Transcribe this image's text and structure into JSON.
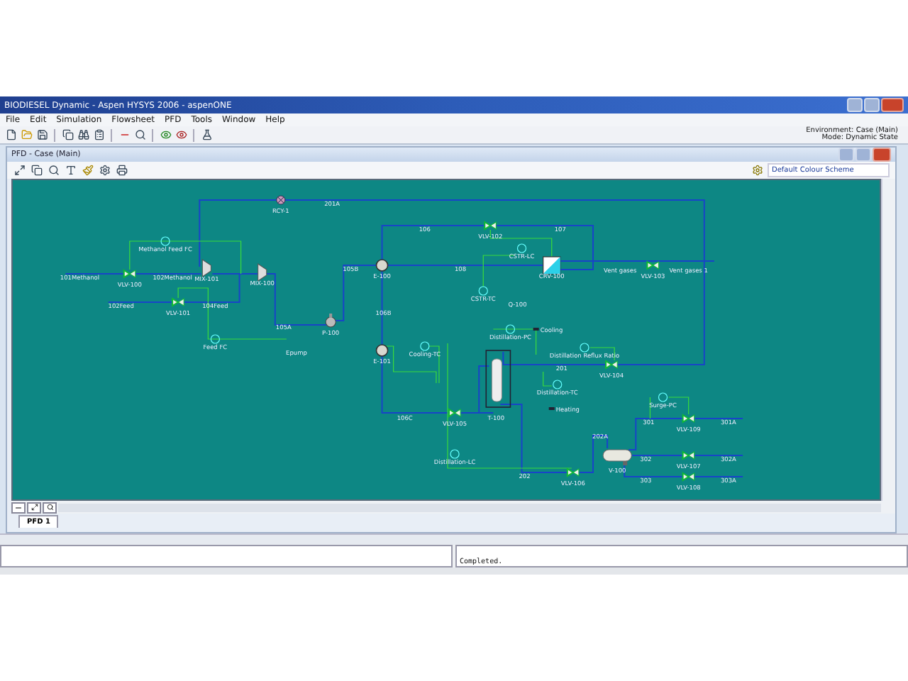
{
  "window": {
    "title": "BIODIESEL Dynamic - Aspen HYSYS 2006 - aspenONE"
  },
  "menu": [
    "File",
    "Edit",
    "Simulation",
    "Flowsheet",
    "PFD",
    "Tools",
    "Window",
    "Help"
  ],
  "environment": {
    "environment": "Environment: Case (Main)",
    "mode": "Mode: Dynamic State"
  },
  "pfd_window": {
    "title": "PFD - Case (Main)",
    "colour_scheme": "Default Colour Scheme"
  },
  "units": [
    {
      "kind": "valve",
      "label": "VLV-100"
    },
    {
      "kind": "valve",
      "label": "VLV-101"
    },
    {
      "kind": "mixer",
      "label": "MIX-101"
    },
    {
      "kind": "mixer",
      "label": "MIX-100"
    },
    {
      "kind": "recycle",
      "label": "RCY-1"
    },
    {
      "kind": "pump",
      "label": "P-100"
    },
    {
      "kind": "heater",
      "label": "E-100"
    },
    {
      "kind": "heater",
      "label": "E-101"
    },
    {
      "kind": "valve",
      "label": "VLV-102"
    },
    {
      "kind": "reactor",
      "label": "CRV-100"
    },
    {
      "kind": "valve",
      "label": "VLV-103"
    },
    {
      "kind": "column",
      "label": "T-100"
    },
    {
      "kind": "valve",
      "label": "VLV-104"
    },
    {
      "kind": "valve",
      "label": "VLV-105"
    },
    {
      "kind": "valve",
      "label": "VLV-106"
    },
    {
      "kind": "drum",
      "label": "V-100"
    },
    {
      "kind": "valve",
      "label": "VLV-109"
    },
    {
      "kind": "valve",
      "label": "VLV-107"
    },
    {
      "kind": "valve",
      "label": "VLV-108"
    }
  ],
  "streams": [
    {
      "label": "101Methanol"
    },
    {
      "label": "102Methanol"
    },
    {
      "label": "102Feed"
    },
    {
      "label": "104Feed"
    },
    {
      "label": "201A"
    },
    {
      "label": "105A"
    },
    {
      "label": "105B"
    },
    {
      "label": "Epump"
    },
    {
      "label": "106"
    },
    {
      "label": "107"
    },
    {
      "label": "108"
    },
    {
      "label": "Q-100"
    },
    {
      "label": "Vent gases"
    },
    {
      "label": "Vent gases 1"
    },
    {
      "label": "106B"
    },
    {
      "label": "106C"
    },
    {
      "label": "201"
    },
    {
      "label": "202"
    },
    {
      "label": "202A"
    },
    {
      "label": "301"
    },
    {
      "label": "301A"
    },
    {
      "label": "302"
    },
    {
      "label": "302A"
    },
    {
      "label": "303"
    },
    {
      "label": "303A"
    }
  ],
  "controllers": [
    {
      "label": "Methanol Feed FC"
    },
    {
      "label": "Feed FC"
    },
    {
      "label": "CSTR-LC"
    },
    {
      "label": "CSTR-TC"
    },
    {
      "label": "Cooling-TC"
    },
    {
      "label": "Distillation-PC"
    },
    {
      "label": "Distillation Reflux Ratio"
    },
    {
      "label": "Distillation-TC"
    },
    {
      "label": "Distillation-LC"
    },
    {
      "label": "Surge-PC"
    }
  ],
  "energy_streams": [
    {
      "label": "Cooling"
    },
    {
      "label": "Heating"
    }
  ],
  "tabs": [
    {
      "label": "PFD 1",
      "selected": true
    }
  ],
  "status": {
    "message": "Completed."
  }
}
